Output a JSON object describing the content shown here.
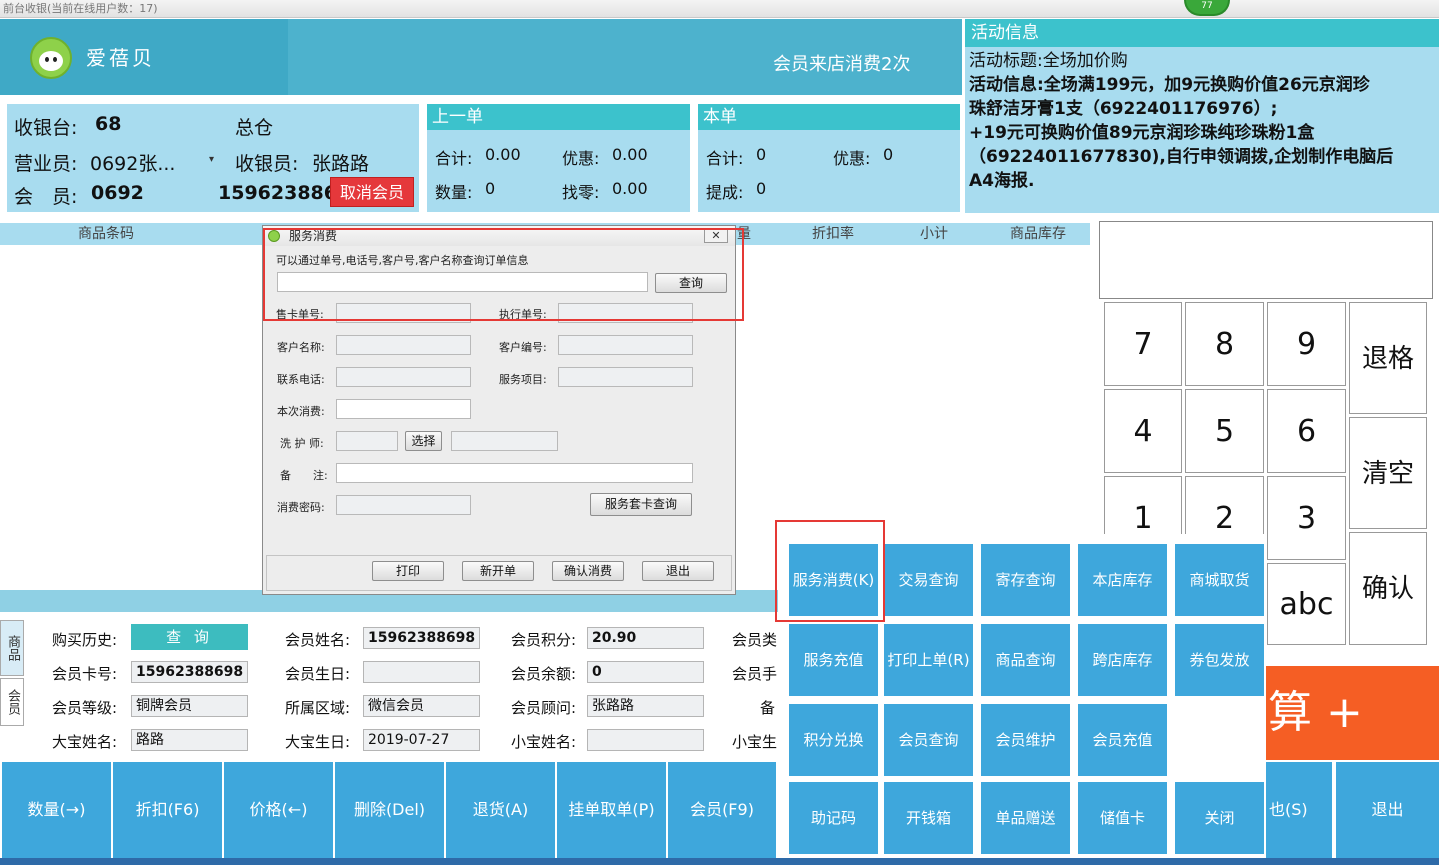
{
  "window": {
    "title": "前台收银(当前在线用户数：17)",
    "badge": "77"
  },
  "header": {
    "brand": "爱蓓贝",
    "visit_notice": "会员来店消费2次"
  },
  "activity": {
    "title": "活动信息",
    "lines": [
      "活动标题:全场加价购",
      "活动信息:全场满199元，加9元换购价值26元京润珍",
      "珠舒洁牙膏1支（6922401176976）;",
      "+19元可换购价值89元京润珍珠纯珍珠粉1盒",
      "（69224011677830),自行申领调拨,企划制作电脑后",
      "A4海报."
    ]
  },
  "info": {
    "register_label": "收银台:",
    "register_value": "68",
    "warehouse": "总仓",
    "staff_label": "营业员:",
    "staff_value": "0692张...",
    "cashier_label": "收银员:",
    "cashier_value": "张路路",
    "member_label": "会　员:",
    "member_id": "0692",
    "member_phone": "159623886",
    "cancel_member": "取消会员"
  },
  "last_order": {
    "title": "上一单",
    "total_label": "合计:",
    "total_value": "0.00",
    "discount_label": "优惠:",
    "discount_value": "0.00",
    "qty_label": "数量:",
    "qty_value": "0",
    "change_label": "找零:",
    "change_value": "0.00"
  },
  "this_order": {
    "title": "本单",
    "total_label": "合计:",
    "total_value": "0",
    "discount_label": "优惠:",
    "discount_value": "0",
    "commission_label": "提成:",
    "commission_value": "0"
  },
  "grid": {
    "columns": [
      "商品条码",
      "量",
      "折扣率",
      "小计",
      "商品库存"
    ]
  },
  "numpad": {
    "keys": [
      "7",
      "8",
      "9",
      "4",
      "5",
      "6",
      "1",
      "2",
      "3",
      "abc"
    ],
    "backspace": "退格",
    "clear": "清空",
    "confirm": "确认"
  },
  "dialog": {
    "title": "服务消费",
    "hint": "可以通过单号,电话号,客户号,客户名称查询订单信息",
    "search_btn": "查询",
    "card_no": "售卡单号:",
    "exec_no": "执行单号:",
    "customer_name": "客户名称:",
    "customer_no": "客户编号:",
    "phone": "联系电话:",
    "service_item": "服务项目:",
    "this_spend": "本次消费:",
    "technician": "洗 护 师:",
    "select_btn": "选择",
    "remark": "备　　注:",
    "password": "消费密码:",
    "package_query": "服务套卡查询",
    "print": "打印",
    "new_order": "新开单",
    "confirm": "确认消费",
    "exit": "退出"
  },
  "member": {
    "tabs": [
      "商品",
      "会员"
    ],
    "history_label": "购买历史:",
    "query_btn": "查 询",
    "name_label": "会员姓名:",
    "name_value": "15962388698",
    "points_label": "会员积分:",
    "points_value": "20.90",
    "type_label": "会员类",
    "card_label": "会员卡号:",
    "card_value": "15962388698",
    "birthday_label": "会员生日:",
    "birthday_value": "",
    "balance_label": "会员余额:",
    "balance_value": "0",
    "mobile_label": "会员手",
    "level_label": "会员等级:",
    "level_value": "铜牌会员",
    "region_label": "所属区域:",
    "region_value": "微信会员",
    "advisor_label": "会员顾问:",
    "advisor_value": "张路路",
    "note_label": "备",
    "child1_label": "大宝姓名:",
    "child1_value": "路路",
    "child1_bday_label": "大宝生日:",
    "child1_bday_value": "2019-07-27",
    "child2_label": "小宝姓名:",
    "child2_value": "",
    "child2_bday_label": "小宝生"
  },
  "bottom_bar": {
    "buttons": [
      "数量(→)",
      "折扣(F6)",
      "价格(←)",
      "删除(Del)",
      "退货(A)",
      "挂单取单(P)",
      "会员(F9)"
    ],
    "right_buttons": [
      "也(S)",
      "退出"
    ]
  },
  "checkout": {
    "label": "算 +"
  },
  "popup_menu": {
    "items": [
      "服务消费(K)",
      "交易查询",
      "寄存查询",
      "本店库存",
      "商城取货",
      "服务充值",
      "打印上单(R)",
      "商品查询",
      "跨店库存",
      "券包发放",
      "积分兑换",
      "会员查询",
      "会员维护",
      "会员充值",
      "助记码",
      "开钱箱",
      "单品赠送",
      "储值卡",
      "关闭"
    ]
  }
}
